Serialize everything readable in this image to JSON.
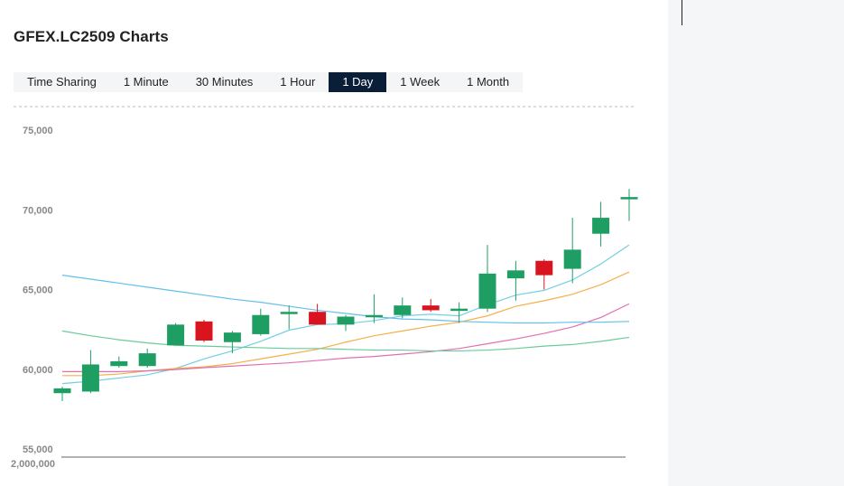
{
  "header": {
    "title": "GFEX.LC2509 Charts"
  },
  "tabs": [
    {
      "label": "Time Sharing",
      "active": false
    },
    {
      "label": "1 Minute",
      "active": false
    },
    {
      "label": "30 Minutes",
      "active": false
    },
    {
      "label": "1 Hour",
      "active": false
    },
    {
      "label": "1 Day",
      "active": true
    },
    {
      "label": "1 Week",
      "active": false
    },
    {
      "label": "1 Month",
      "active": false
    }
  ],
  "colors": {
    "up": "#1e9e63",
    "down": "#d9141e",
    "accent": "#0b1e38"
  },
  "chart_data": {
    "type": "candlestick",
    "ylim": [
      55000,
      75000
    ],
    "yticks": [
      "75,000",
      "70,000",
      "65,000",
      "60,000",
      "55,000"
    ],
    "volume_tick": "2,000,000",
    "candles": [
      {
        "o": 58500,
        "h": 58900,
        "l": 58000,
        "c": 58800
      },
      {
        "o": 58600,
        "h": 61200,
        "l": 58500,
        "c": 60300
      },
      {
        "o": 60200,
        "h": 60800,
        "l": 60100,
        "c": 60500
      },
      {
        "o": 60200,
        "h": 61300,
        "l": 60100,
        "c": 61000
      },
      {
        "o": 61500,
        "h": 62900,
        "l": 61500,
        "c": 62800
      },
      {
        "o": 63000,
        "h": 63100,
        "l": 61700,
        "c": 61800
      },
      {
        "o": 61700,
        "h": 62400,
        "l": 61000,
        "c": 62300
      },
      {
        "o": 62200,
        "h": 63800,
        "l": 62100,
        "c": 63400
      },
      {
        "o": 63500,
        "h": 64000,
        "l": 62500,
        "c": 63600
      },
      {
        "o": 63600,
        "h": 64100,
        "l": 62800,
        "c": 62800
      },
      {
        "o": 62800,
        "h": 63400,
        "l": 62400,
        "c": 63300
      },
      {
        "o": 63300,
        "h": 64700,
        "l": 62900,
        "c": 63400
      },
      {
        "o": 63400,
        "h": 64500,
        "l": 63200,
        "c": 64000
      },
      {
        "o": 64000,
        "h": 64400,
        "l": 63600,
        "c": 63700
      },
      {
        "o": 63700,
        "h": 64200,
        "l": 62900,
        "c": 63800
      },
      {
        "o": 63800,
        "h": 67800,
        "l": 63600,
        "c": 66000
      },
      {
        "o": 65700,
        "h": 66800,
        "l": 64300,
        "c": 66200
      },
      {
        "o": 66800,
        "h": 66900,
        "l": 65000,
        "c": 65900
      },
      {
        "o": 66300,
        "h": 69500,
        "l": 65400,
        "c": 67500
      },
      {
        "o": 68500,
        "h": 70500,
        "l": 67700,
        "c": 69500
      },
      {
        "o": 70700,
        "h": 71300,
        "l": 69300,
        "c": 70800
      }
    ],
    "moving_averages": [
      {
        "color": "#74cfe3",
        "values": [
          59100,
          59250,
          59450,
          59650,
          60050,
          60650,
          61150,
          61750,
          62450,
          62800,
          62850,
          63050,
          63350,
          63450,
          63350,
          64050,
          64650,
          64950,
          65600,
          66600,
          67800
        ]
      },
      {
        "color": "#f5b04a",
        "values": [
          59600,
          59600,
          59700,
          59900,
          60050,
          60150,
          60350,
          60650,
          60950,
          61250,
          61700,
          62100,
          62400,
          62700,
          62950,
          63350,
          63950,
          64300,
          64700,
          65300,
          66100
        ]
      },
      {
        "color": "#e070b0",
        "values": [
          59850,
          59850,
          59850,
          59900,
          59980,
          60100,
          60200,
          60300,
          60400,
          60550,
          60700,
          60800,
          60950,
          61100,
          61300,
          61600,
          61900,
          62250,
          62650,
          63250,
          64100
        ]
      },
      {
        "color": "#6acb9a",
        "values": [
          62400,
          62100,
          61850,
          61650,
          61500,
          61450,
          61400,
          61350,
          61300,
          61300,
          61250,
          61200,
          61200,
          61150,
          61150,
          61200,
          61300,
          61450,
          61550,
          61750,
          62000
        ]
      },
      {
        "color": "#62c0ec",
        "values": [
          65900,
          65650,
          65400,
          65150,
          64900,
          64650,
          64400,
          64200,
          63950,
          63700,
          63500,
          63300,
          63150,
          63100,
          63000,
          62950,
          62900,
          62900,
          62950,
          62950,
          63000
        ]
      }
    ]
  }
}
